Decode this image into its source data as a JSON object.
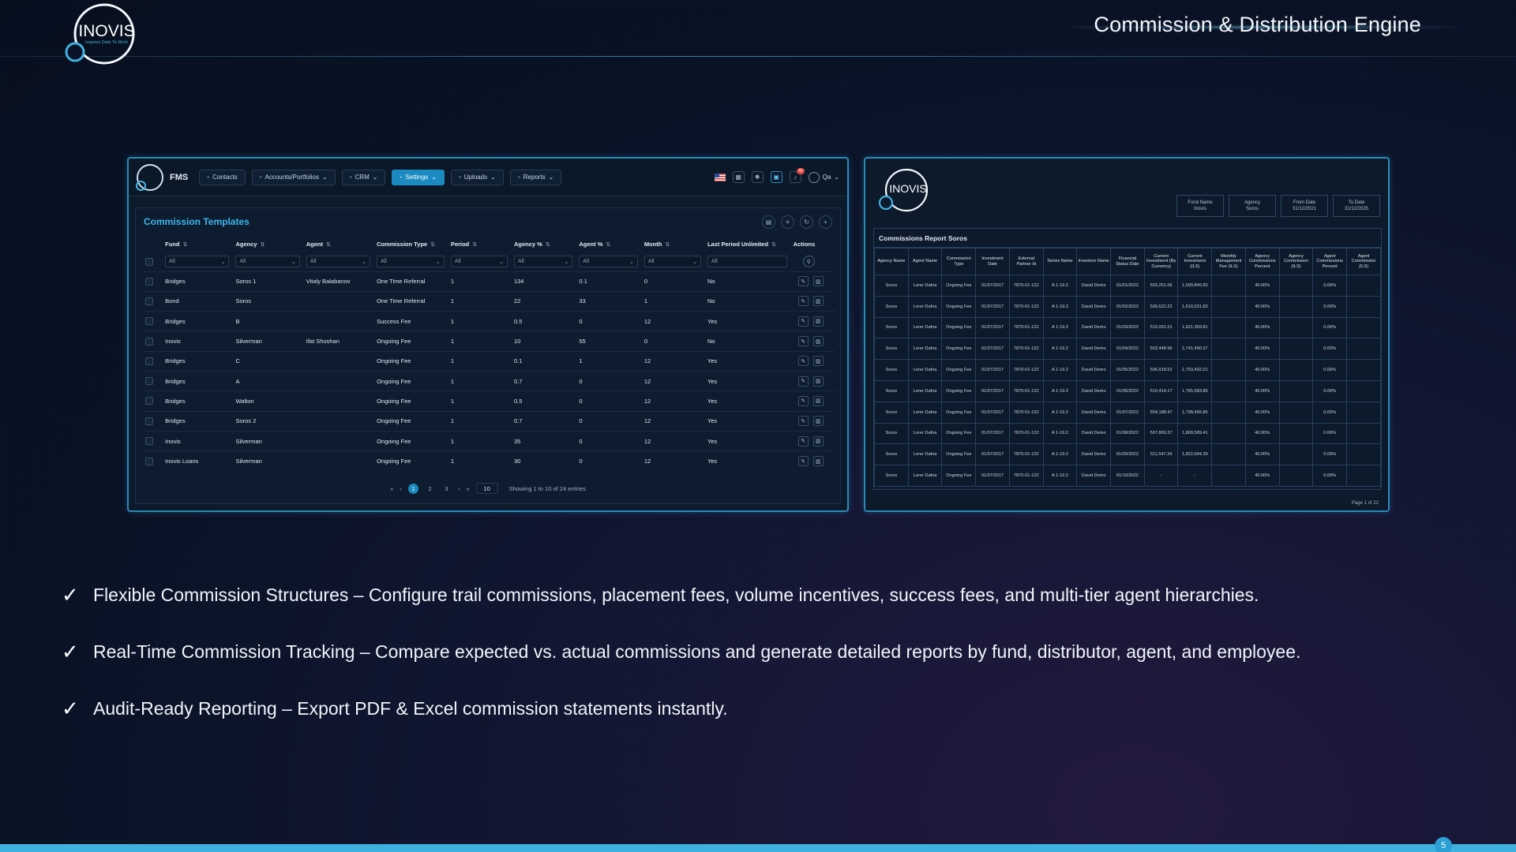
{
  "slide": {
    "title": "Commission & Distribution Engine",
    "logo_text": "INOVIS",
    "logo_tagline": "Inspires Data To Work",
    "page_number": "5"
  },
  "fms": {
    "app_name": "FMS",
    "nav": [
      {
        "label": "Contacts",
        "icon": "contacts-icon",
        "active": false,
        "dropdown": false
      },
      {
        "label": "Accounts/Portfolios",
        "icon": "accounts-icon",
        "active": false,
        "dropdown": true
      },
      {
        "label": "CRM",
        "icon": "crm-icon",
        "active": false,
        "dropdown": true
      },
      {
        "label": "Settings",
        "icon": "settings-icon",
        "active": true,
        "dropdown": true
      },
      {
        "label": "Uploads",
        "icon": "upload-icon",
        "active": false,
        "dropdown": true
      },
      {
        "label": "Reports",
        "icon": "reports-icon",
        "active": false,
        "dropdown": true
      }
    ],
    "notification_count": "40",
    "user": "Qa",
    "section_title": "Commission Templates",
    "columns": [
      "Fund",
      "Agency",
      "Agent",
      "Commission Type",
      "Period",
      "Agency %",
      "Agent %",
      "Month",
      "Last Period Unlimited",
      "Actions"
    ],
    "filter_placeholder": "All",
    "rows": [
      [
        "Bridges",
        "Soros 1",
        "Vitaly Balabanov",
        "One Time Referral",
        "1",
        "134",
        "0.1",
        "0",
        "No"
      ],
      [
        "Bond",
        "Soros",
        "",
        "One Time Referral",
        "1",
        "22",
        "33",
        "1",
        "No"
      ],
      [
        "Bridges",
        "B",
        "",
        "Success Fee",
        "1",
        "0.5",
        "0",
        "12",
        "Yes"
      ],
      [
        "Inovis",
        "Silverman",
        "Ifat Shoshan",
        "Ongoing Fee",
        "1",
        "10",
        "55",
        "0",
        "No"
      ],
      [
        "Bridges",
        "C",
        "",
        "Ongoing Fee",
        "1",
        "0.1",
        "1",
        "12",
        "Yes"
      ],
      [
        "Bridges",
        "A",
        "",
        "Ongoing Fee",
        "1",
        "0.7",
        "0",
        "12",
        "Yes"
      ],
      [
        "Bridges",
        "Walton",
        "",
        "Ongoing Fee",
        "1",
        "0.5",
        "0",
        "12",
        "Yes"
      ],
      [
        "Bridges",
        "Soros 2",
        "",
        "Ongoing Fee",
        "1",
        "0.7",
        "0",
        "12",
        "Yes"
      ],
      [
        "Inovis",
        "Silverman",
        "",
        "Ongoing Fee",
        "1",
        "35",
        "0",
        "12",
        "Yes"
      ],
      [
        "Inovis Loans",
        "Silverman",
        "",
        "Ongoing Fee",
        "1",
        "30",
        "0",
        "12",
        "Yes"
      ]
    ],
    "pagination": {
      "pages": [
        "1",
        "2",
        "3"
      ],
      "current": "1",
      "page_size": "10",
      "info": "Showing 1 to 10 of 24 entries"
    }
  },
  "report": {
    "title": "Commissions Report Soros",
    "filters": [
      {
        "label": "Fund Name",
        "value": "Inovis"
      },
      {
        "label": "Agency",
        "value": "Soros"
      },
      {
        "label": "From Date",
        "value": "31/12/2021"
      },
      {
        "label": "To Date",
        "value": "31/12/2025"
      }
    ],
    "columns": [
      "Agency Name",
      "Agent Name",
      "Commission Type",
      "Investment Date",
      "External Partner Id",
      "Series Name",
      "Investors Name",
      "Financial Status Date",
      "Current Investment (By Currency)",
      "Current Investment (ILS)",
      "Monthly Management Fee (ILS)",
      "Agency Commissions Percent",
      "Agency Commission (ILS)",
      "Agent Commissions Percent",
      "Agent Commission (ILS)"
    ],
    "rows": [
      [
        "Soros",
        "Lerer Dafna",
        "Ongoing Fee",
        "01/07/2017",
        "7870-01-122",
        "A 1-19.2",
        "David Demo",
        "01/01/2022",
        "503,261.06",
        "1,599,846.83",
        "",
        "40.00%",
        "",
        "0.00%",
        ""
      ],
      [
        "Soros",
        "Lerer Dafna",
        "Ongoing Fee",
        "01/07/2017",
        "7870-01-122",
        "A 1-19.2",
        "David Demo",
        "01/02/2022",
        "506,622.22",
        "1,610,531.83",
        "",
        "40.00%",
        "",
        "0.00%",
        ""
      ],
      [
        "Soros",
        "Lerer Dafna",
        "Ongoing Fee",
        "01/07/2017",
        "7870-01-122",
        "A 1-19.2",
        "David Demo",
        "01/03/2022",
        "510,031.51",
        "1,621,369.81",
        "",
        "40.00%",
        "",
        "0.00%",
        ""
      ],
      [
        "Soros",
        "Lerer Dafna",
        "Ongoing Fee",
        "01/07/2017",
        "7870-01-122",
        "A 1-19.2",
        "David Demo",
        "01/04/2022",
        "503,448.96",
        "1,741,490.37",
        "",
        "40.00%",
        "",
        "0.00%",
        ""
      ],
      [
        "Soros",
        "Lerer Dafna",
        "Ongoing Fee",
        "01/07/2017",
        "7870-01-122",
        "A 1-19.2",
        "David Demo",
        "01/05/2022",
        "506,918.52",
        "1,753,492.01",
        "",
        "40.00%",
        "",
        "0.00%",
        ""
      ],
      [
        "Soros",
        "Lerer Dafna",
        "Ongoing Fee",
        "01/07/2017",
        "7870-01-122",
        "A 1-19.2",
        "David Demo",
        "01/06/2022",
        "510,414.17",
        "1,765,583.89",
        "",
        "40.00%",
        "",
        "0.00%",
        ""
      ],
      [
        "Soros",
        "Lerer Dafna",
        "Ongoing Fee",
        "01/07/2017",
        "7870-01-122",
        "A 1-19.2",
        "David Demo",
        "01/07/2022",
        "504,188.47",
        "1,798,466.86",
        "",
        "40.00%",
        "",
        "0.00%",
        ""
      ],
      [
        "Soros",
        "Lerer Dafna",
        "Ongoing Fee",
        "01/07/2017",
        "7870-01-122",
        "A 1-19.2",
        "David Demo",
        "01/08/2022",
        "507,869.37",
        "1,809,589.41",
        "",
        "40.00%",
        "",
        "0.00%",
        ""
      ],
      [
        "Soros",
        "Lerer Dafna",
        "Ongoing Fee",
        "01/07/2017",
        "7870-01-122",
        "A 1-19.2",
        "David Demo",
        "01/09/2022",
        "511,547.34",
        "1,822,694.39",
        "",
        "40.00%",
        "",
        "0.00%",
        ""
      ],
      [
        "Soros",
        "Lerer Dafna",
        "Ongoing Fee",
        "01/07/2017",
        "7870-01-122",
        "A 1-19.2",
        "David Demo",
        "01/10/2022",
        "-",
        "-",
        "",
        "40.00%",
        "",
        "0.00%",
        ""
      ]
    ],
    "page_info": "Page 1 of 22"
  },
  "bullets": [
    "Flexible Commission Structures – Configure trail commissions, placement fees, volume incentives, success fees, and multi-tier agent hierarchies.",
    "Real-Time Commission Tracking – Compare expected vs. actual commissions and generate detailed reports by fund, distributor, agent, and employee.",
    "Audit-Ready Reporting – Export PDF & Excel commission statements instantly."
  ],
  "bullet_mark": "✓",
  "colors": {
    "accent": "#3fb1df",
    "active_nav": "#1a8ac0",
    "title_blue": "#3fb6ea",
    "background": "#0a1327"
  }
}
